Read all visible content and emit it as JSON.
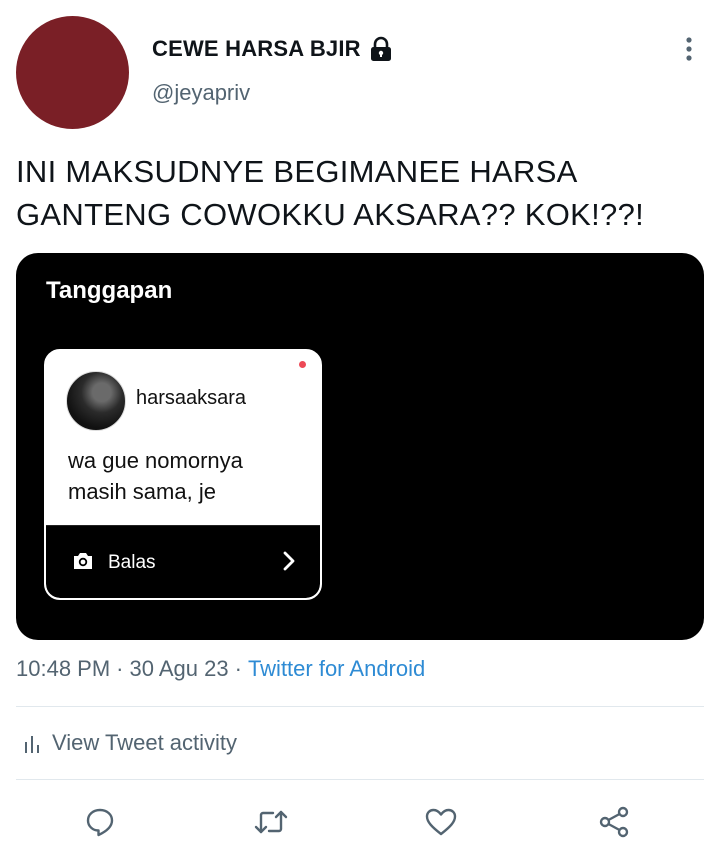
{
  "author": {
    "display_name": "CEWE HARSA BJIR",
    "handle": "@jeyapriv",
    "avatar_color": "#7a1f26",
    "protected_icon": "lock-icon"
  },
  "tweet": {
    "text": "INI MAKSUDNYE BEGIMANEE HARSA\nGANTENG COWOKKU AKSARA?? KOK!??!"
  },
  "media": {
    "title": "Tanggapan",
    "card": {
      "username": "harsaaksara",
      "message": "wa gue nomornya\nmasih sama, je",
      "reply_label": "Balas",
      "reply_icon": "camera-icon",
      "chevron_icon": "chevron-right-icon",
      "unread_dot_color": "#ed4956"
    }
  },
  "meta": {
    "time": "10:48 PM",
    "separator": "·",
    "date": "30 Agu 23",
    "source": "Twitter for Android"
  },
  "activity": {
    "label": "View Tweet activity",
    "icon": "chart-icon"
  },
  "actions": [
    {
      "name": "reply",
      "icon": "speech-bubble-icon"
    },
    {
      "name": "retweet",
      "icon": "retweet-icon"
    },
    {
      "name": "like",
      "icon": "heart-icon"
    },
    {
      "name": "share",
      "icon": "share-icon"
    }
  ],
  "colors": {
    "text": "#0f1419",
    "secondary": "#536471",
    "link": "#2e8bd4",
    "divider": "#e1e8ed"
  }
}
